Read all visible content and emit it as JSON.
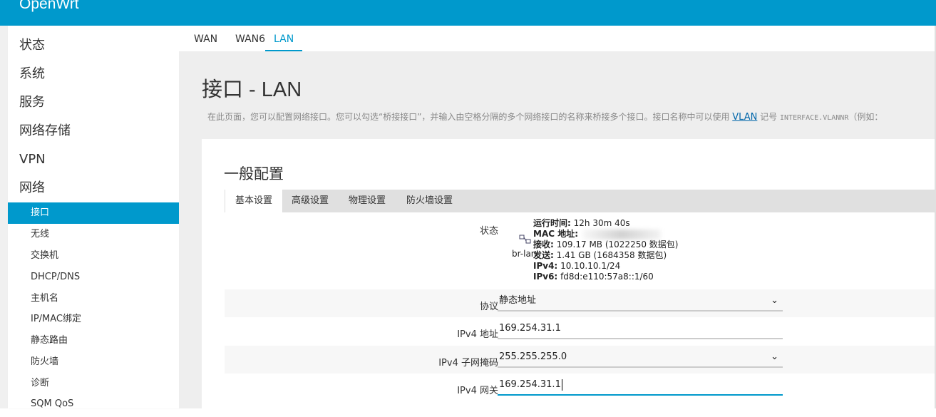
{
  "brand": "OpenWrt",
  "sidebar": {
    "top_items": [
      "状态",
      "系统",
      "服务",
      "网络存储",
      "VPN",
      "网络"
    ],
    "sub_items": [
      "接口",
      "无线",
      "交换机",
      "DHCP/DNS",
      "主机名",
      "IP/MAC绑定",
      "静态路由",
      "防火墙",
      "诊断",
      "SQM QoS"
    ],
    "active_sub": "接口"
  },
  "top_tabs": [
    "WAN",
    "WAN6",
    "LAN"
  ],
  "active_top_tab": "LAN",
  "page": {
    "title": "接口 - LAN",
    "desc_prefix": "在此页面，您可以配置网络接口。您可以勾选“桥接接口”，并输入由空格分隔的多个网络接口的名称来桥接多个接口。接口名称中可以使用",
    "desc_link": "VLAN",
    "desc_mid": "记号",
    "desc_mono": "INTERFACE.VLANNR",
    "desc_suffix": "（例如："
  },
  "section": {
    "title": "一般配置",
    "tabs": [
      "基本设置",
      "高级设置",
      "物理设置",
      "防火墙设置"
    ],
    "active_tab": "基本设置"
  },
  "status": {
    "label": "状态",
    "iface_name": "br-lan",
    "uptime_label": "运行时间:",
    "uptime_value": "12h 30m 40s",
    "mac_label": "MAC 地址:",
    "rx_label": "接收:",
    "rx_value": "109.17 MB (1022250 数据包)",
    "tx_label": "发送:",
    "tx_value": "1.41 GB (1684358 数据包)",
    "ipv4_label": "IPv4:",
    "ipv4_value": "10.10.10.1/24",
    "ipv6_label": "IPv6:",
    "ipv6_value": "fd8d:e110:57a8::1/60"
  },
  "form": {
    "protocol_label": "协议",
    "protocol_value": "静态地址",
    "ipv4_addr_label": "IPv4 地址",
    "ipv4_addr_value": "169.254.31.1",
    "netmask_label": "IPv4 子网掩码",
    "netmask_value": "255.255.255.0",
    "gateway_label": "IPv4 网关",
    "gateway_value": "169.254.31.1"
  },
  "icons": {
    "chevron": "chevron-down-icon",
    "network": "network-icon"
  },
  "colors": {
    "accent": "#0099cc",
    "background": "#eeeeee"
  }
}
